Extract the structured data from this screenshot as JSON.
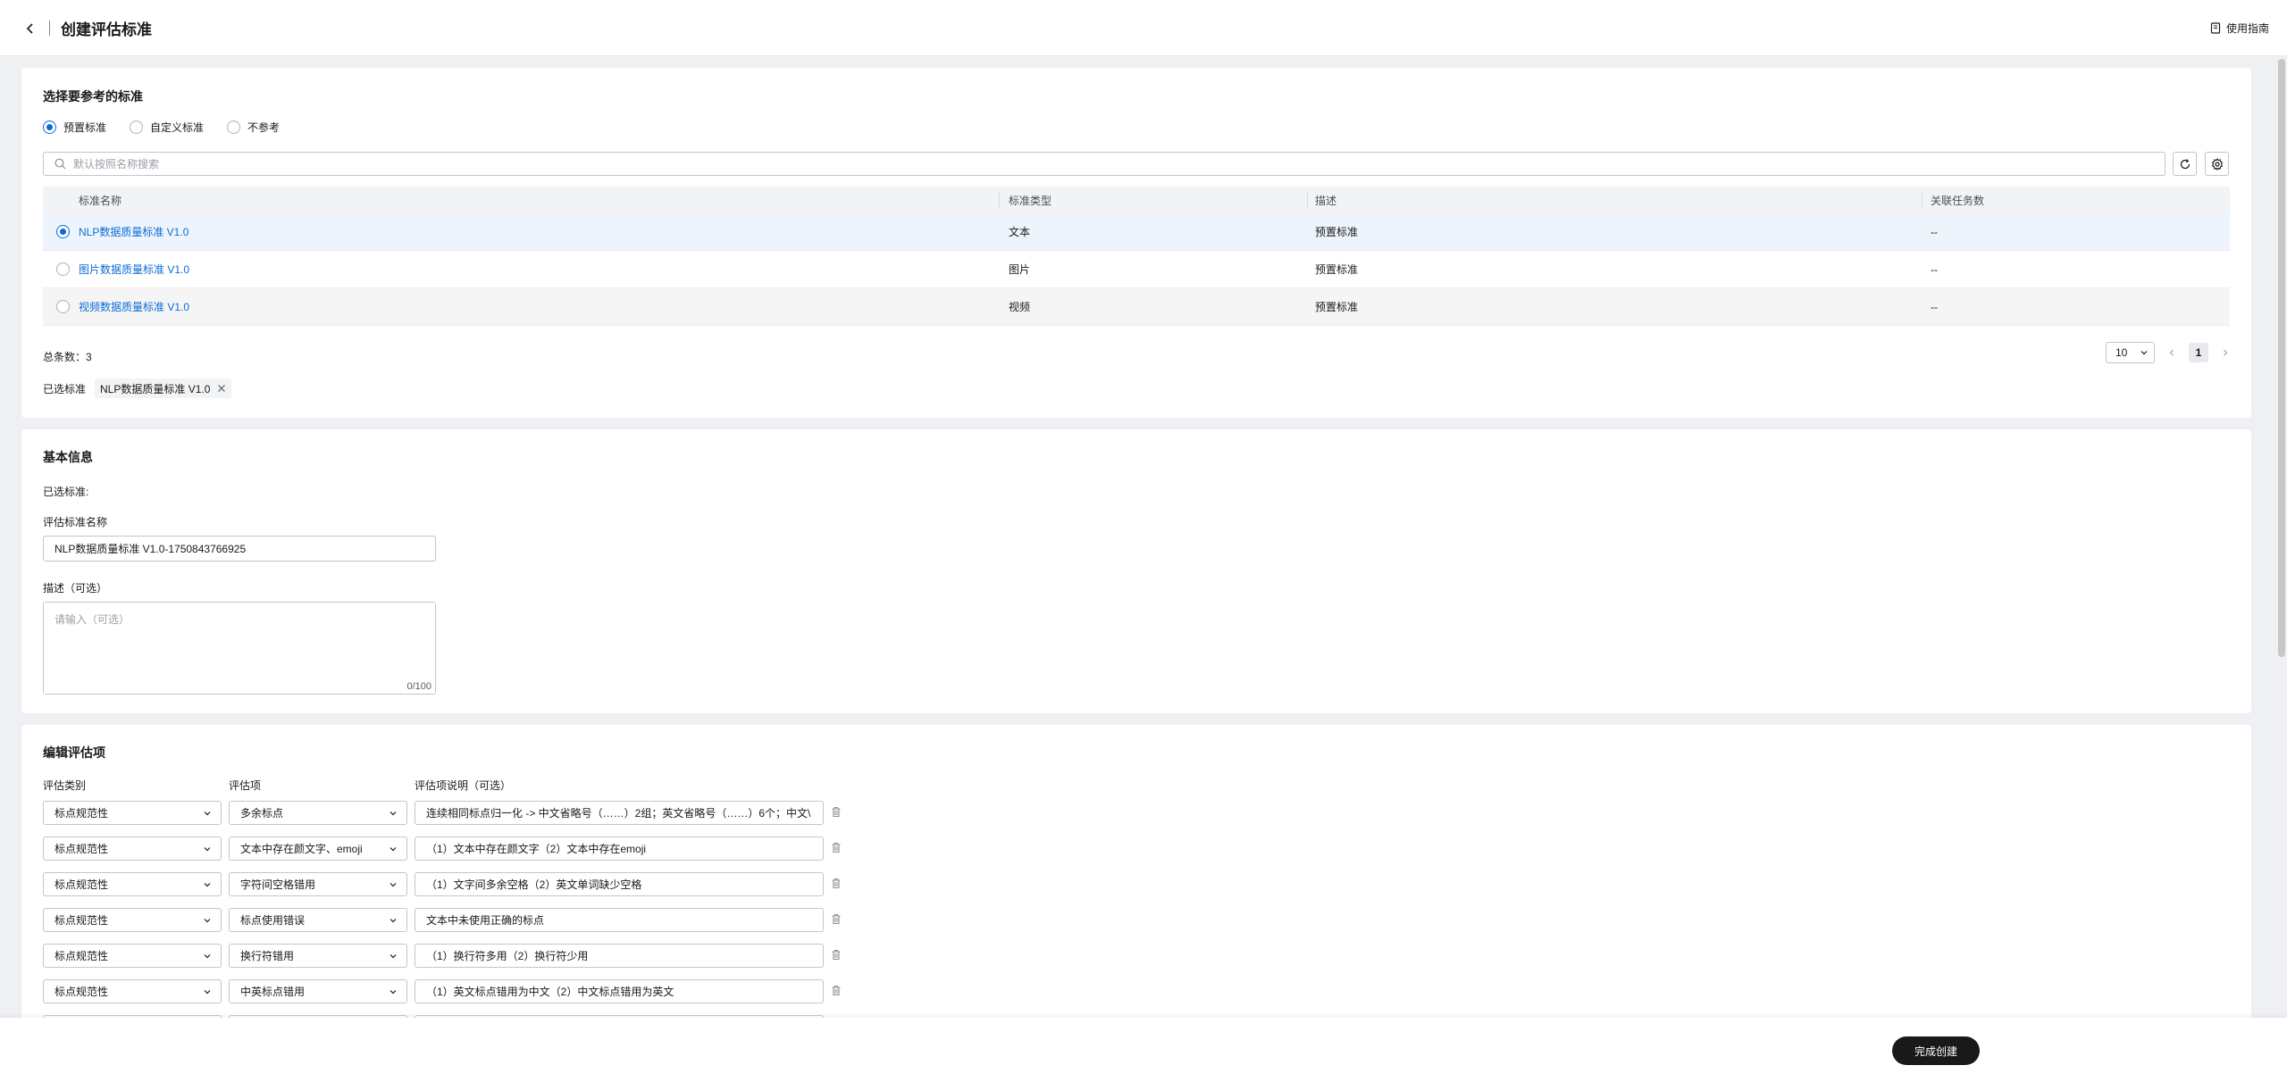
{
  "header": {
    "title": "创建评估标准",
    "guide_label": "使用指南"
  },
  "reference": {
    "section_title": "选择要参考的标准",
    "options": [
      {
        "label": "预置标准",
        "selected": true
      },
      {
        "label": "自定义标准",
        "selected": false
      },
      {
        "label": "不参考",
        "selected": false
      }
    ],
    "search_placeholder": "默认按照名称搜索",
    "columns": [
      "标准名称",
      "标准类型",
      "描述",
      "关联任务数"
    ],
    "rows": [
      {
        "name": "NLP数据质量标准 V1.0",
        "type": "文本",
        "desc": "预置标准",
        "tasks": "--",
        "selected": true
      },
      {
        "name": "图片数据质量标准 V1.0",
        "type": "图片",
        "desc": "预置标准",
        "tasks": "--",
        "selected": false
      },
      {
        "name": "视频数据质量标准 V1.0",
        "type": "视频",
        "desc": "预置标准",
        "tasks": "--",
        "selected": false
      }
    ],
    "total_label": "总条数：3",
    "page_size": "10",
    "current_page": "1",
    "chosen_label": "已选标准",
    "chosen_tag": "NLP数据质量标准 V1.0"
  },
  "basic": {
    "section_title": "基本信息",
    "chosen_label": "已选标准:",
    "name_label": "评估标准名称",
    "name_value": "NLP数据质量标准 V1.0-1750843766925",
    "desc_label": "描述（可选）",
    "desc_placeholder": "请输入（可选）",
    "desc_count": "0/100"
  },
  "items": {
    "section_title": "编辑评估项",
    "headers": [
      "评估类别",
      "评估项",
      "评估项说明（可选）"
    ],
    "rows": [
      {
        "category": "标点规范性",
        "item": "多余标点",
        "note": "连续相同标点归一化 -> 中文省略号（……）2组；英文省略号（……）6个；中文\\"
      },
      {
        "category": "标点规范性",
        "item": "文本中存在颜文字、emoji",
        "note": "（1）文本中存在颜文字（2）文本中存在emoji"
      },
      {
        "category": "标点规范性",
        "item": "字符间空格错用",
        "note": "（1）文字间多余空格（2）英文单词缺少空格"
      },
      {
        "category": "标点规范性",
        "item": "标点使用错误",
        "note": "文本中未使用正确的标点"
      },
      {
        "category": "标点规范性",
        "item": "换行符错用",
        "note": "（1）换行符多用（2）换行符少用"
      },
      {
        "category": "标点规范性",
        "item": "中英标点错用",
        "note": "（1）英文标点错用为中文（2）中文标点错用为英文"
      }
    ]
  },
  "footer": {
    "submit_label": "完成创建"
  }
}
